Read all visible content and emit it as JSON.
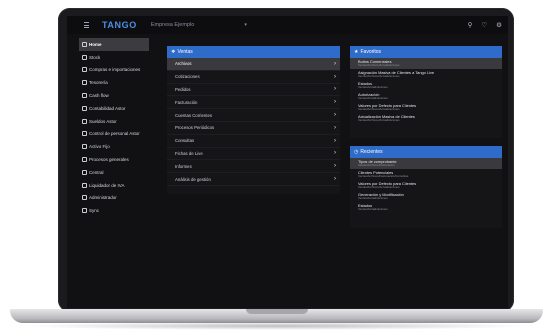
{
  "topbar": {
    "logo": "TANGO",
    "company": "Empresa Ejemplo"
  },
  "sidebar": {
    "items": [
      {
        "label": "Home",
        "icon": "home-icon",
        "active": true
      },
      {
        "label": "Stock",
        "icon": "box-icon"
      },
      {
        "label": "Compras e importaciones",
        "icon": "cart-icon"
      },
      {
        "label": "Tesorería",
        "icon": "bank-icon"
      },
      {
        "label": "Cash flow",
        "icon": "cashflow-icon"
      },
      {
        "label": "Contabilidad Astor",
        "icon": "ledger-icon"
      },
      {
        "label": "Sueldos Astor",
        "icon": "wallet-icon"
      },
      {
        "label": "Control de personal Astor",
        "icon": "clock-icon"
      },
      {
        "label": "Activo Fijo",
        "icon": "asset-icon"
      },
      {
        "label": "Procesos generales",
        "icon": "gear-icon"
      },
      {
        "label": "Central",
        "icon": "server-icon"
      },
      {
        "label": "Liquidador de IVA",
        "icon": "tax-icon"
      },
      {
        "label": "Administrador",
        "icon": "admin-icon"
      },
      {
        "label": "Sync",
        "icon": "sync-icon"
      }
    ]
  },
  "ventas": {
    "title": "Ventas",
    "items": [
      "Archivos",
      "Cotizaciones",
      "Pedidos",
      "Facturación",
      "Cuentas Corrientes",
      "Procesos Periódicos",
      "Consultas",
      "Fichas de Live",
      "Informes",
      "Análisis de gestión"
    ]
  },
  "favoritos": {
    "title": "Favoritos",
    "items": [
      {
        "title": "Bultos Comerciales",
        "sub": "Ventas/Archivos/Actualizaciones"
      },
      {
        "title": "Asignación Masiva de Clientes a Tango Live",
        "sub": "Ventas/Archivos/Actualizaciones"
      },
      {
        "title": "Estados",
        "sub": "Ventas/Actualizaciones"
      },
      {
        "title": "Autorización",
        "sub": "Ventas/Actualizaciones"
      },
      {
        "title": "Valores por Defecto para Clientes",
        "sub": "Ventas/Archivos/Actualizaciones"
      },
      {
        "title": "Actualización Masiva de Clientes",
        "sub": "Ventas/Archivos/Actualizaciones"
      }
    ]
  },
  "recientes": {
    "title": "Recientes",
    "items": [
      {
        "title": "Tipos de comprobante",
        "sub": "Ventas/Archivos/Facturación"
      },
      {
        "title": "Clientes Potenciales",
        "sub": "Ventas/Archivos/Facturación/Consultas"
      },
      {
        "title": "Valores por Defecto para Clientes",
        "sub": "Ventas/Archivos/Actualizaciones"
      },
      {
        "title": "Generación y Modificación",
        "sub": "Ventas/Actualizaciones"
      },
      {
        "title": "Estados",
        "sub": "Ventas/Actualizaciones"
      }
    ]
  }
}
